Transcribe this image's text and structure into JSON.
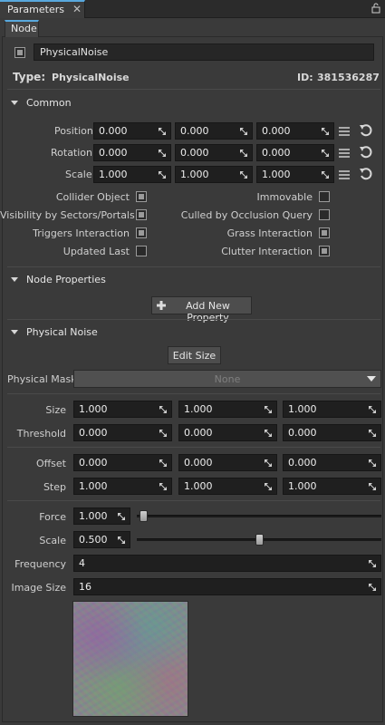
{
  "tab": {
    "title": "Parameters",
    "close": "✕"
  },
  "subtab": {
    "label": "Node"
  },
  "node": {
    "name": "PhysicalNoise",
    "type_label": "Type:",
    "type_value": "PhysicalNoise",
    "id_label": "ID:",
    "id_value": "381536287"
  },
  "common": {
    "title": "Common",
    "position": {
      "label": "Position",
      "values": [
        "0.000",
        "0.000",
        "0.000"
      ]
    },
    "rotation": {
      "label": "Rotation",
      "values": [
        "0.000",
        "0.000",
        "0.000"
      ]
    },
    "scale": {
      "label": "Scale",
      "values": [
        "1.000",
        "1.000",
        "1.000"
      ]
    },
    "flags_left": [
      {
        "label": "Collider Object",
        "checked": true
      },
      {
        "label": "Visibility by Sectors/Portals",
        "checked": true
      },
      {
        "label": "Triggers Interaction",
        "checked": true
      },
      {
        "label": "Updated Last",
        "checked": false
      }
    ],
    "flags_right": [
      {
        "label": "Immovable",
        "checked": false
      },
      {
        "label": "Culled by Occlusion Query",
        "checked": false
      },
      {
        "label": "Grass Interaction",
        "checked": true
      },
      {
        "label": "Clutter Interaction",
        "checked": true
      }
    ]
  },
  "node_properties": {
    "title": "Node Properties",
    "add_button": "Add New Property"
  },
  "physical_noise": {
    "title": "Physical Noise",
    "edit_size_button": "Edit Size",
    "mask_label": "Physical Mask",
    "mask_value": "None",
    "size": {
      "label": "Size",
      "values": [
        "1.000",
        "1.000",
        "1.000"
      ]
    },
    "threshold": {
      "label": "Threshold",
      "values": [
        "0.000",
        "0.000",
        "0.000"
      ]
    },
    "offset": {
      "label": "Offset",
      "values": [
        "0.000",
        "0.000",
        "0.000"
      ]
    },
    "step": {
      "label": "Step",
      "values": [
        "1.000",
        "1.000",
        "1.000"
      ]
    },
    "force": {
      "label": "Force",
      "value": "1.000",
      "slider_fraction": 0.0
    },
    "scale": {
      "label": "Scale",
      "value": "0.500",
      "slider_fraction": 0.5
    },
    "frequency": {
      "label": "Frequency",
      "value": "4"
    },
    "image_size": {
      "label": "Image Size",
      "value": "16"
    }
  }
}
